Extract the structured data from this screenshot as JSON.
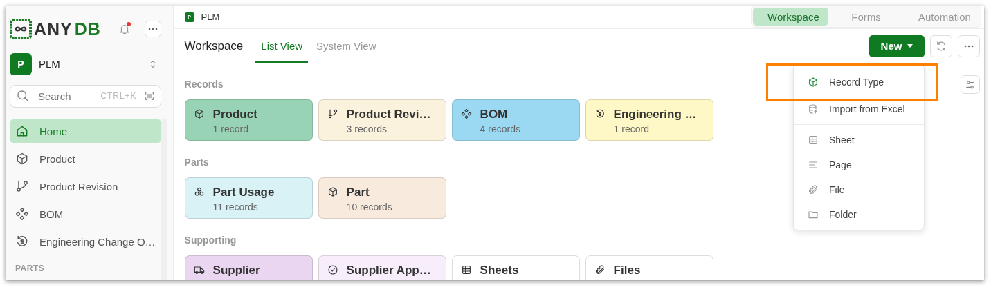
{
  "logo": {
    "prefix": "ANY",
    "suffix": "DB"
  },
  "sidebar": {
    "notifications": {
      "unread": true
    },
    "workspace": {
      "avatar": "P",
      "name": "PLM"
    },
    "search": {
      "placeholder": "Search",
      "shortcut": "CTRL+K"
    },
    "items": [
      {
        "label": "Home",
        "selected": true
      },
      {
        "label": "Product",
        "selected": false
      },
      {
        "label": "Product Revision",
        "selected": false
      },
      {
        "label": "BOM",
        "selected": false
      },
      {
        "label": "Engineering Change O…",
        "selected": false
      }
    ],
    "section": "PARTS"
  },
  "breadcrumb": {
    "avatar": "P",
    "label": "PLM"
  },
  "mode_tabs": [
    {
      "label": "Workspace",
      "selected": true
    },
    {
      "label": "Forms",
      "selected": false
    },
    {
      "label": "Automation",
      "selected": false
    }
  ],
  "page": {
    "title": "Workspace",
    "tabs": [
      {
        "label": "List View",
        "selected": true
      },
      {
        "label": "System View",
        "selected": false
      }
    ],
    "new_button": "New"
  },
  "sections": [
    {
      "title": "Records",
      "cards": [
        {
          "title": "Product",
          "count": "1 record",
          "color": "#99d3b5"
        },
        {
          "title": "Product Revi…",
          "count": "3 records",
          "color": "#faf2dc"
        },
        {
          "title": "BOM",
          "count": "4 records",
          "color": "#9bd9f2"
        },
        {
          "title": "Engineering …",
          "count": "1 record",
          "color": "#fef8c6"
        }
      ]
    },
    {
      "title": "Parts",
      "cards": [
        {
          "title": "Part Usage",
          "count": "11 records",
          "color": "#d8f2f6"
        },
        {
          "title": "Part",
          "count": "10 records",
          "color": "#f8eadc"
        }
      ]
    },
    {
      "title": "Supporting",
      "cards": [
        {
          "title": "Supplier",
          "color": "#ebd6f2"
        },
        {
          "title": "Supplier App…",
          "color": "#f8eefb"
        },
        {
          "title": "Sheets",
          "color": "#ffffff"
        },
        {
          "title": "Files",
          "color": "#ffffff"
        }
      ]
    }
  ],
  "new_menu": {
    "groups": [
      [
        {
          "label": "Record Type",
          "highlighted": true
        },
        {
          "label": "Import from Excel",
          "highlighted": false
        }
      ],
      [
        {
          "label": "Sheet",
          "highlighted": false
        },
        {
          "label": "Page",
          "highlighted": false
        },
        {
          "label": "File",
          "highlighted": false
        },
        {
          "label": "Folder",
          "highlighted": false
        }
      ]
    ]
  }
}
